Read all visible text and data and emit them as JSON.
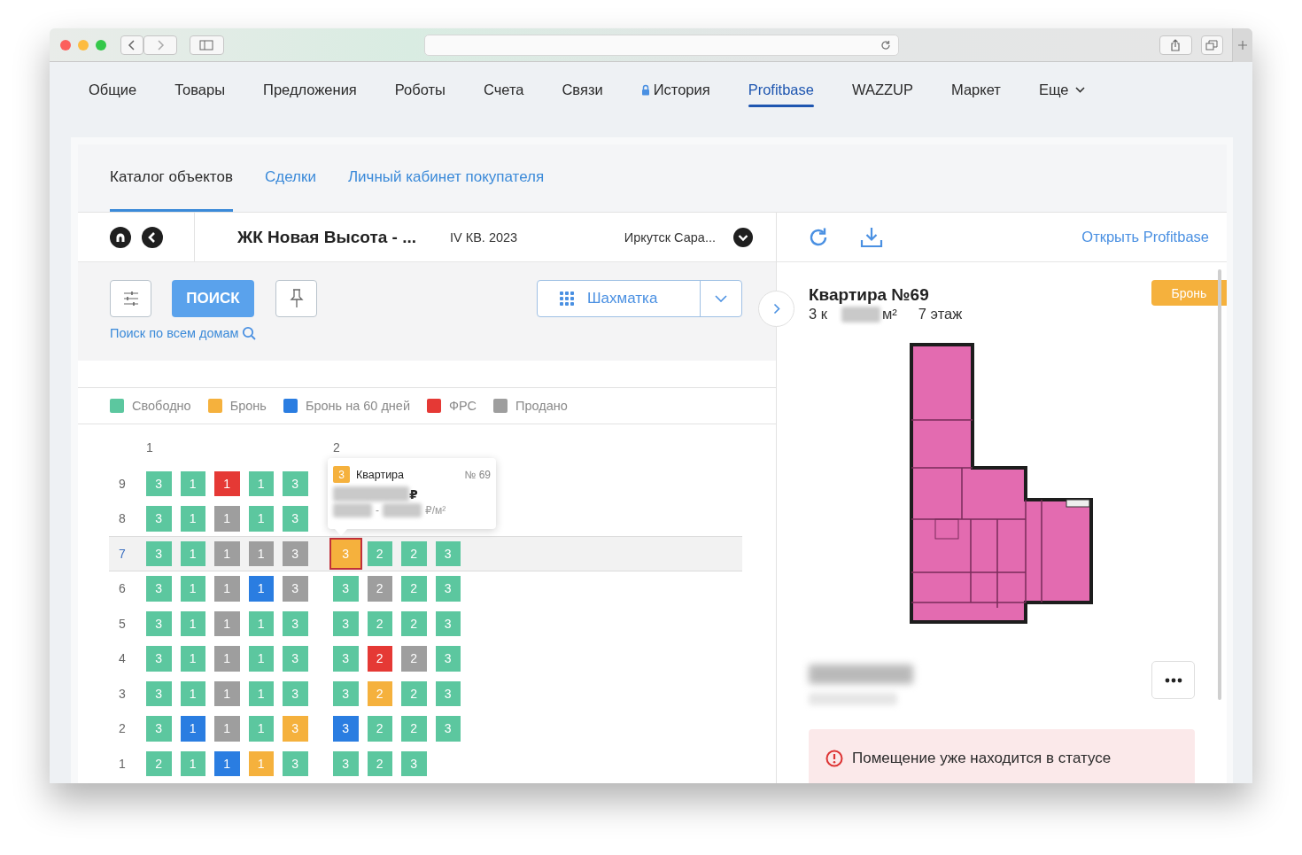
{
  "nav": [
    {
      "label": "Общие",
      "kind": "link",
      "selected": false
    },
    {
      "label": "Товары",
      "kind": "link",
      "selected": false
    },
    {
      "label": "Предложения",
      "kind": "link",
      "selected": false
    },
    {
      "label": "Роботы",
      "kind": "link",
      "selected": false
    },
    {
      "label": "Счета",
      "kind": "link",
      "selected": false
    },
    {
      "label": "Связи",
      "kind": "link",
      "selected": false
    },
    {
      "label": "История",
      "kind": "locked",
      "selected": false
    },
    {
      "label": "Profitbase",
      "kind": "link",
      "selected": true
    },
    {
      "label": "WAZZUP",
      "kind": "link",
      "selected": false
    },
    {
      "label": "Маркет",
      "kind": "link",
      "selected": false
    },
    {
      "label": "Еще",
      "kind": "dropdown",
      "selected": false
    }
  ],
  "subtabs": [
    {
      "label": "Каталог объектов",
      "selected": true
    },
    {
      "label": "Сделки",
      "selected": false
    },
    {
      "label": "Личный кабинет покупателя",
      "selected": false
    }
  ],
  "project": {
    "title": "ЖК Новая Высота - ...",
    "deadline": "IV КВ. 2023",
    "city": "Иркутск Сара..."
  },
  "toolbar": {
    "search_button": "ПОИСК",
    "search_all": "Поиск по всем домам",
    "view": "Шахматка"
  },
  "legend": [
    {
      "label": "Свободно",
      "color": "#5cc79f"
    },
    {
      "label": "Бронь",
      "color": "#f5b13d"
    },
    {
      "label": "Бронь на 60 дней",
      "color": "#2a7de1"
    },
    {
      "label": "ФРС",
      "color": "#e53935"
    },
    {
      "label": "Продано",
      "color": "#9e9e9e"
    }
  ],
  "sections": [
    {
      "label": "1"
    },
    {
      "label": "2"
    }
  ],
  "floors": [
    {
      "label": "9",
      "selected": false,
      "sections": [
        [
          {
            "rooms": "3",
            "color": "#5cc79f",
            "selected": false
          },
          {
            "rooms": "1",
            "color": "#5cc79f",
            "selected": false
          },
          {
            "rooms": "1",
            "color": "#e53935",
            "selected": false
          },
          {
            "rooms": "1",
            "color": "#5cc79f",
            "selected": false
          },
          {
            "rooms": "3",
            "color": "#5cc79f",
            "selected": false
          }
        ]
      ]
    },
    {
      "label": "8",
      "selected": false,
      "sections": [
        [
          {
            "rooms": "3",
            "color": "#5cc79f",
            "selected": false
          },
          {
            "rooms": "1",
            "color": "#5cc79f",
            "selected": false
          },
          {
            "rooms": "1",
            "color": "#9e9e9e",
            "selected": false
          },
          {
            "rooms": "1",
            "color": "#5cc79f",
            "selected": false
          },
          {
            "rooms": "3",
            "color": "#5cc79f",
            "selected": false
          }
        ]
      ]
    },
    {
      "label": "7",
      "selected": true,
      "sections": [
        [
          {
            "rooms": "3",
            "color": "#5cc79f",
            "selected": false
          },
          {
            "rooms": "1",
            "color": "#5cc79f",
            "selected": false
          },
          {
            "rooms": "1",
            "color": "#9e9e9e",
            "selected": false
          },
          {
            "rooms": "1",
            "color": "#9e9e9e",
            "selected": false
          },
          {
            "rooms": "3",
            "color": "#9e9e9e",
            "selected": false
          }
        ],
        [
          {
            "rooms": "3",
            "color": "#f5b13d",
            "selected": true
          },
          {
            "rooms": "2",
            "color": "#5cc79f",
            "selected": false
          },
          {
            "rooms": "2",
            "color": "#5cc79f",
            "selected": false
          },
          {
            "rooms": "3",
            "color": "#5cc79f",
            "selected": false
          }
        ]
      ]
    },
    {
      "label": "6",
      "selected": false,
      "sections": [
        [
          {
            "rooms": "3",
            "color": "#5cc79f",
            "selected": false
          },
          {
            "rooms": "1",
            "color": "#5cc79f",
            "selected": false
          },
          {
            "rooms": "1",
            "color": "#9e9e9e",
            "selected": false
          },
          {
            "rooms": "1",
            "color": "#2a7de1",
            "selected": false
          },
          {
            "rooms": "3",
            "color": "#9e9e9e",
            "selected": false
          }
        ],
        [
          {
            "rooms": "3",
            "color": "#5cc79f",
            "selected": false
          },
          {
            "rooms": "2",
            "color": "#9e9e9e",
            "selected": false
          },
          {
            "rooms": "2",
            "color": "#5cc79f",
            "selected": false
          },
          {
            "rooms": "3",
            "color": "#5cc79f",
            "selected": false
          }
        ]
      ]
    },
    {
      "label": "5",
      "selected": false,
      "sections": [
        [
          {
            "rooms": "3",
            "color": "#5cc79f",
            "selected": false
          },
          {
            "rooms": "1",
            "color": "#5cc79f",
            "selected": false
          },
          {
            "rooms": "1",
            "color": "#9e9e9e",
            "selected": false
          },
          {
            "rooms": "1",
            "color": "#5cc79f",
            "selected": false
          },
          {
            "rooms": "3",
            "color": "#5cc79f",
            "selected": false
          }
        ],
        [
          {
            "rooms": "3",
            "color": "#5cc79f",
            "selected": false
          },
          {
            "rooms": "2",
            "color": "#5cc79f",
            "selected": false
          },
          {
            "rooms": "2",
            "color": "#5cc79f",
            "selected": false
          },
          {
            "rooms": "3",
            "color": "#5cc79f",
            "selected": false
          }
        ]
      ]
    },
    {
      "label": "4",
      "selected": false,
      "sections": [
        [
          {
            "rooms": "3",
            "color": "#5cc79f",
            "selected": false
          },
          {
            "rooms": "1",
            "color": "#5cc79f",
            "selected": false
          },
          {
            "rooms": "1",
            "color": "#9e9e9e",
            "selected": false
          },
          {
            "rooms": "1",
            "color": "#5cc79f",
            "selected": false
          },
          {
            "rooms": "3",
            "color": "#5cc79f",
            "selected": false
          }
        ],
        [
          {
            "rooms": "3",
            "color": "#5cc79f",
            "selected": false
          },
          {
            "rooms": "2",
            "color": "#e53935",
            "selected": false
          },
          {
            "rooms": "2",
            "color": "#9e9e9e",
            "selected": false
          },
          {
            "rooms": "3",
            "color": "#5cc79f",
            "selected": false
          }
        ]
      ]
    },
    {
      "label": "3",
      "selected": false,
      "sections": [
        [
          {
            "rooms": "3",
            "color": "#5cc79f",
            "selected": false
          },
          {
            "rooms": "1",
            "color": "#5cc79f",
            "selected": false
          },
          {
            "rooms": "1",
            "color": "#9e9e9e",
            "selected": false
          },
          {
            "rooms": "1",
            "color": "#5cc79f",
            "selected": false
          },
          {
            "rooms": "3",
            "color": "#5cc79f",
            "selected": false
          }
        ],
        [
          {
            "rooms": "3",
            "color": "#5cc79f",
            "selected": false
          },
          {
            "rooms": "2",
            "color": "#f5b13d",
            "selected": false
          },
          {
            "rooms": "2",
            "color": "#5cc79f",
            "selected": false
          },
          {
            "rooms": "3",
            "color": "#5cc79f",
            "selected": false
          }
        ]
      ]
    },
    {
      "label": "2",
      "selected": false,
      "sections": [
        [
          {
            "rooms": "3",
            "color": "#5cc79f",
            "selected": false
          },
          {
            "rooms": "1",
            "color": "#2a7de1",
            "selected": false
          },
          {
            "rooms": "1",
            "color": "#9e9e9e",
            "selected": false
          },
          {
            "rooms": "1",
            "color": "#5cc79f",
            "selected": false
          },
          {
            "rooms": "3",
            "color": "#f5b13d",
            "selected": false
          }
        ],
        [
          {
            "rooms": "3",
            "color": "#2a7de1",
            "selected": false
          },
          {
            "rooms": "2",
            "color": "#5cc79f",
            "selected": false
          },
          {
            "rooms": "2",
            "color": "#5cc79f",
            "selected": false
          },
          {
            "rooms": "3",
            "color": "#5cc79f",
            "selected": false
          }
        ]
      ]
    },
    {
      "label": "1",
      "selected": false,
      "sections": [
        [
          {
            "rooms": "2",
            "color": "#5cc79f",
            "selected": false
          },
          {
            "rooms": "1",
            "color": "#5cc79f",
            "selected": false
          },
          {
            "rooms": "1",
            "color": "#2a7de1",
            "selected": false
          },
          {
            "rooms": "1",
            "color": "#f5b13d",
            "selected": false
          },
          {
            "rooms": "3",
            "color": "#5cc79f",
            "selected": false
          }
        ],
        [
          {
            "rooms": "3",
            "color": "#5cc79f",
            "selected": false
          },
          {
            "rooms": "2",
            "color": "#5cc79f",
            "selected": false
          },
          {
            "rooms": "3",
            "color": "#5cc79f",
            "selected": false
          }
        ]
      ]
    }
  ],
  "tooltip": {
    "rooms": "3",
    "color": "#f5b13d",
    "title": "Квартира",
    "number": "№ 69",
    "price_suffix": "₽",
    "range_separator": "-",
    "unit": "₽/м²"
  },
  "details": {
    "link": "Открыть Profitbase",
    "title": "Квартира №69",
    "status": "Бронь",
    "rooms": "3 к",
    "area_unit": "м²",
    "floor": "7 этаж",
    "alert": "Помещение уже находится в статусе"
  }
}
